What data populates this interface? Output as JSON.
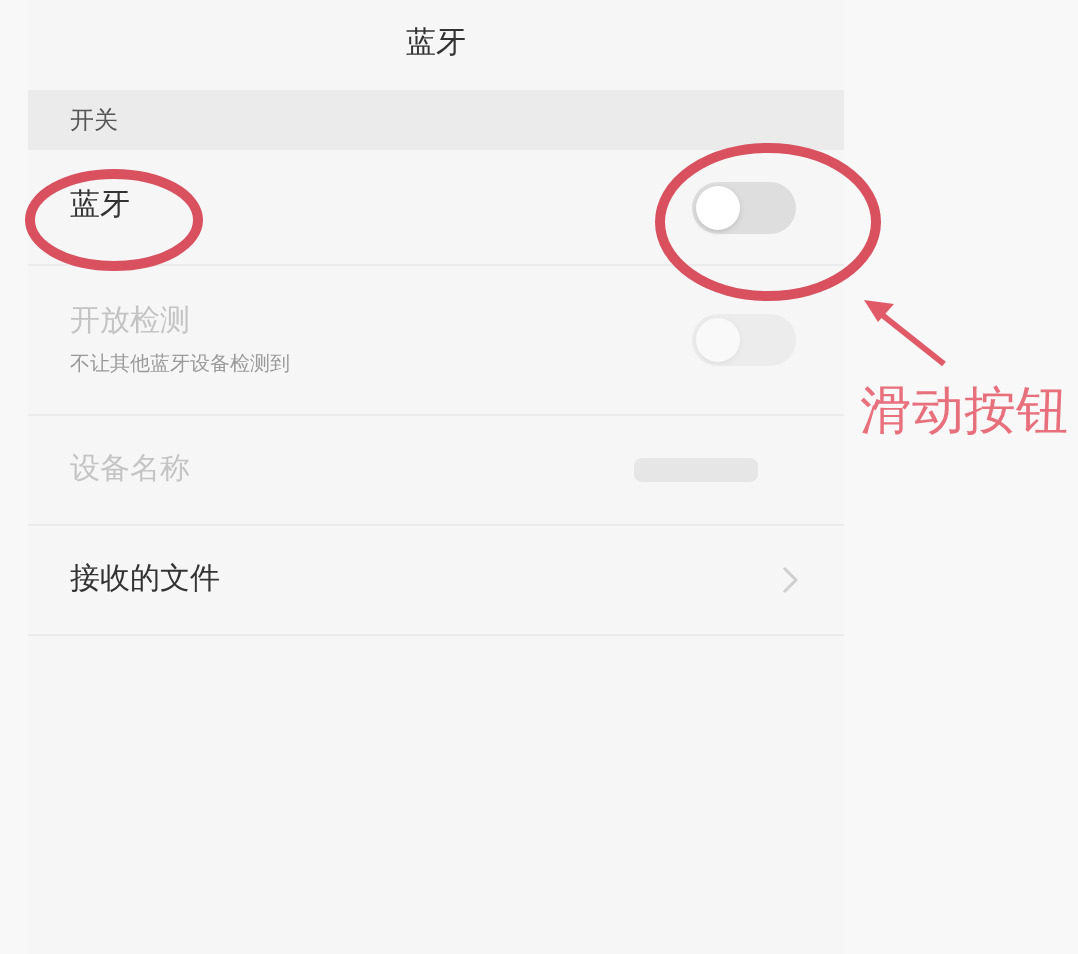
{
  "title": "蓝牙",
  "section": "开关",
  "rows": [
    {
      "kind": "toggle",
      "label": "蓝牙",
      "on": false,
      "disabled": false
    },
    {
      "kind": "toggle",
      "label": "开放检测",
      "subtitle": "不让其他蓝牙设备检测到",
      "on": false,
      "disabled": true
    },
    {
      "kind": "value",
      "label": "设备名称",
      "disabled": true
    },
    {
      "kind": "link",
      "label": "接收的文件",
      "disabled": false
    }
  ],
  "annotation": {
    "label": "滑动按钮"
  }
}
